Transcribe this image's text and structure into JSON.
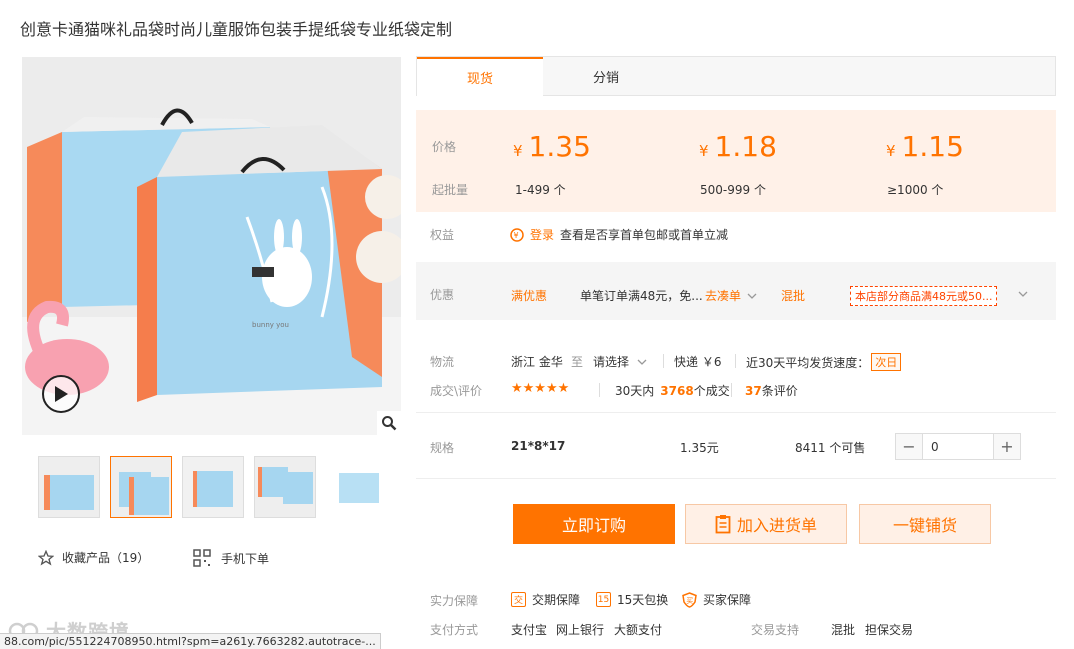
{
  "title": "创意卡通猫咪礼品袋时尚儿童服饰包装手提纸袋专业纸袋定制",
  "tabs": [
    "现货",
    "分销"
  ],
  "price_section": {
    "price_label": "价格",
    "moq_label": "起批量",
    "currency": "¥",
    "tiers": [
      {
        "price": "1.35",
        "range": "1-499 个"
      },
      {
        "price": "1.18",
        "range": "500-999 个"
      },
      {
        "price": "1.15",
        "range": "≥1000 个"
      }
    ]
  },
  "rights": {
    "label": "权益",
    "login": "登录",
    "text": "查看是否享首单包邮或首单立减"
  },
  "promo": {
    "label": "优惠",
    "full_discount": "满优惠",
    "discount_text": "单笔订单满48元，免...",
    "go_combine": "去凑单",
    "mixed": "混批",
    "tag": "本店部分商品满48元或50..."
  },
  "logistics": {
    "label": "物流",
    "origin": "浙江 金华",
    "to": "至",
    "select": "请选择",
    "express": "快递 ￥6",
    "ship_speed": "近30天平均发货速度：",
    "next_day": "次日"
  },
  "reviews": {
    "label": "成交\\评价",
    "stars": "★★★★★",
    "rating": 5,
    "deals_prefix": "30天内",
    "deals_count": "3768",
    "deals_suffix": "个成交",
    "review_count": "37",
    "review_suffix": "条评价"
  },
  "spec": {
    "label": "规格",
    "name": "21*8*17",
    "price": "1.35元",
    "stock": "8411 个可售",
    "qty": "0",
    "minus": "−",
    "plus": "+"
  },
  "actions": {
    "order": "立即订购",
    "cart": "加入进货单",
    "distribute": "一键铺货"
  },
  "guarantee": {
    "label": "实力保障",
    "items": [
      "交期保障",
      "15天包换",
      "买家保障"
    ],
    "icon_text": [
      "交",
      "15",
      "买"
    ]
  },
  "payment": {
    "label": "支付方式",
    "methods": [
      "支付宝",
      "网上银行",
      "大额支付"
    ],
    "trade_label": "交易支持",
    "trade": [
      "混批",
      "担保交易"
    ]
  },
  "left": {
    "favorite": "收藏产品（19）",
    "mobile": "手机下单"
  },
  "watermark": "大数跨境",
  "url": "88.com/pic/551224708950.html?spm=a261y.7663282.autotrace-...",
  "colors": {
    "accent": "#ff7300",
    "price_bg": "#fff1e8",
    "bag_blue": "#a8d8f0",
    "bag_orange": "#f68a5a"
  }
}
